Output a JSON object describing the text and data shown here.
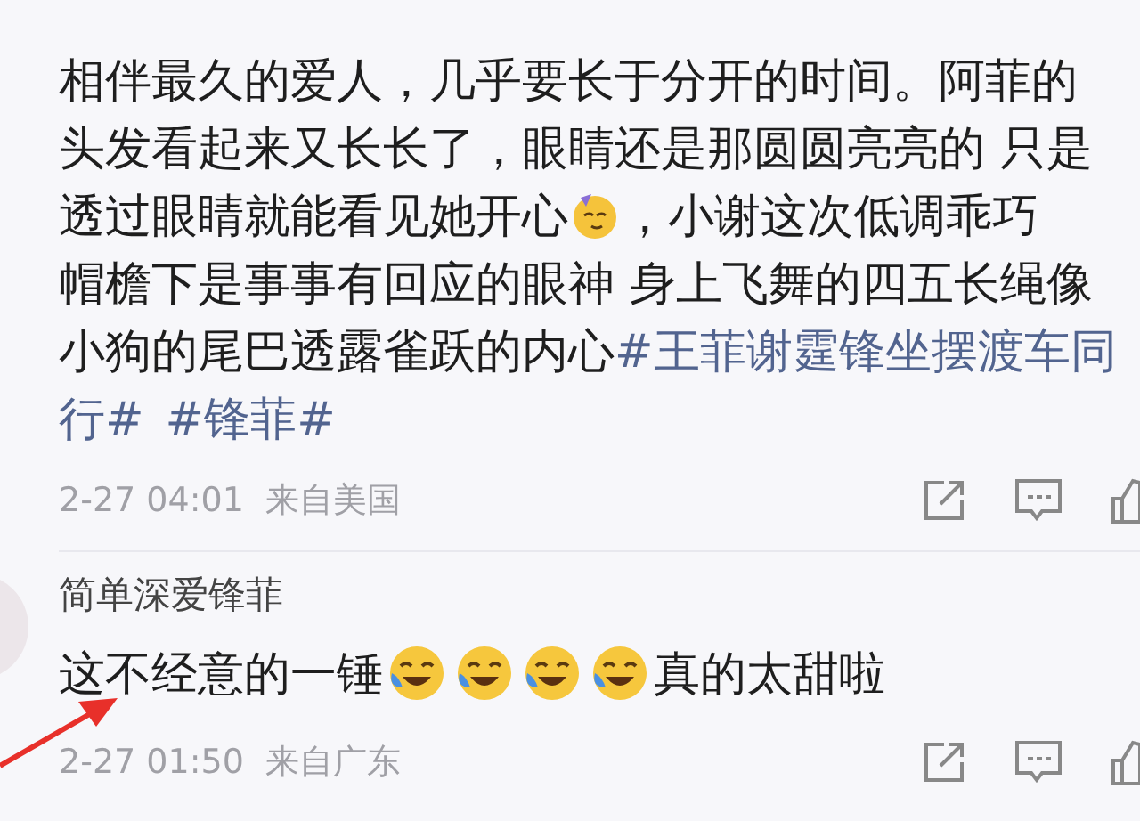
{
  "post": {
    "lines": [
      [
        {
          "kind": "text",
          "text": "相伴最久的爱人，几乎要长于分开的时间。阿菲的"
        }
      ],
      [
        {
          "kind": "text",
          "text": "头发看起来又长长了，眼睛还是那圆圆亮亮的 只是"
        }
      ],
      [
        {
          "kind": "text",
          "text": "透过眼睛就能看见她开心"
        },
        {
          "kind": "emoji"
        },
        {
          "kind": "text",
          "text": "，小谢这次低调乖巧"
        }
      ],
      [
        {
          "kind": "text",
          "text": "帽檐下是事事有回应的眼神 身上飞舞的四五长绳像"
        }
      ],
      [
        {
          "kind": "text",
          "text": "小狗的尾巴透露雀跃的内心"
        },
        {
          "kind": "hashtag",
          "text": "#王菲谢霆锋坐摆渡车同"
        }
      ],
      [
        {
          "kind": "hashtag",
          "text": "行#"
        },
        {
          "kind": "hashtag",
          "text": "#锋菲#"
        }
      ]
    ],
    "time": "2-27 04:01",
    "source": "来自美国"
  },
  "comment": {
    "user": "简单深爱锋菲",
    "segments": [
      {
        "kind": "text",
        "text": "这不经意的一锤"
      },
      {
        "kind": "emoji"
      },
      {
        "kind": "emoji"
      },
      {
        "kind": "emoji"
      },
      {
        "kind": "emoji"
      },
      {
        "kind": "text",
        "text": "真的太甜啦"
      }
    ],
    "time": "2-27 01:50",
    "source": "来自广东"
  }
}
